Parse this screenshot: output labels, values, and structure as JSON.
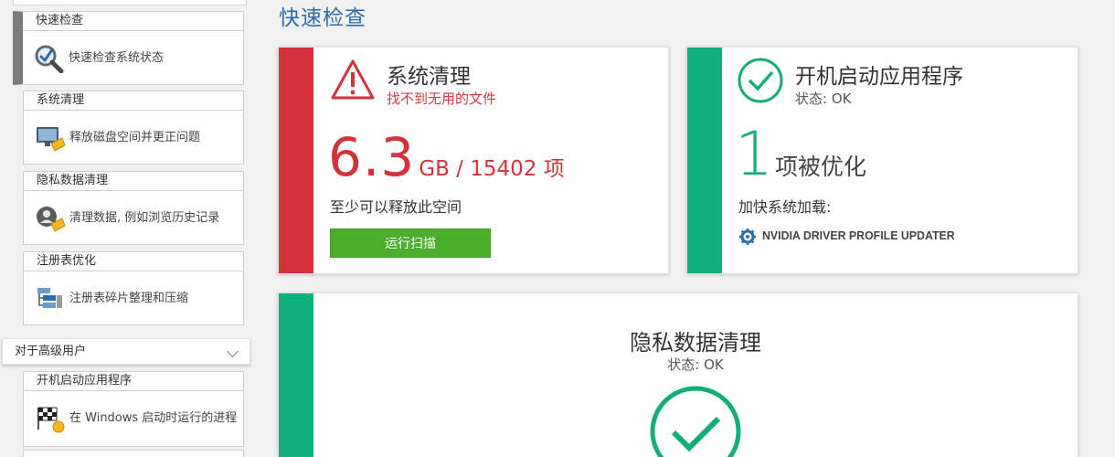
{
  "sidebar": {
    "sections": [
      {
        "header": "快速检查",
        "text": "快速检查系统状态",
        "icon": "magnifier-check-icon"
      },
      {
        "header": "系统清理",
        "text": "释放磁盘空间并更正问题",
        "icon": "pc-broom-icon"
      },
      {
        "header": "隐私数据清理",
        "text": "清理数据, 例如浏览历史记录",
        "icon": "privacy-broom-icon"
      },
      {
        "header": "注册表优化",
        "text": "注册表碎片整理和压缩",
        "icon": "registry-tree-icon"
      }
    ],
    "advanced": "对于高级用户",
    "advanced_sections": [
      {
        "header": "开机启动应用程序",
        "text": "在 Windows 启动时运行的进程",
        "icon": "startup-flag-icon"
      }
    ]
  },
  "main": {
    "title": "快速检查",
    "cleanup_card": {
      "title": "系统清理",
      "subtitle": "找不到无用的文件",
      "size_value": "6.3",
      "size_unit": "GB / 15402 项",
      "description": "至少可以释放此空间",
      "button": "运行扫描",
      "accent": "#d2323c"
    },
    "startup_card": {
      "title": "开机启动应用程序",
      "status": "状态: OK",
      "count": "1",
      "count_label": "项被优化",
      "description": "加快系统加载:",
      "item": "NVIDIA DRIVER PROFILE UPDATER",
      "accent": "#11ad7b"
    },
    "privacy_card": {
      "title": "隐私数据清理",
      "status": "状态: OK",
      "accent": "#11ad7b"
    }
  }
}
